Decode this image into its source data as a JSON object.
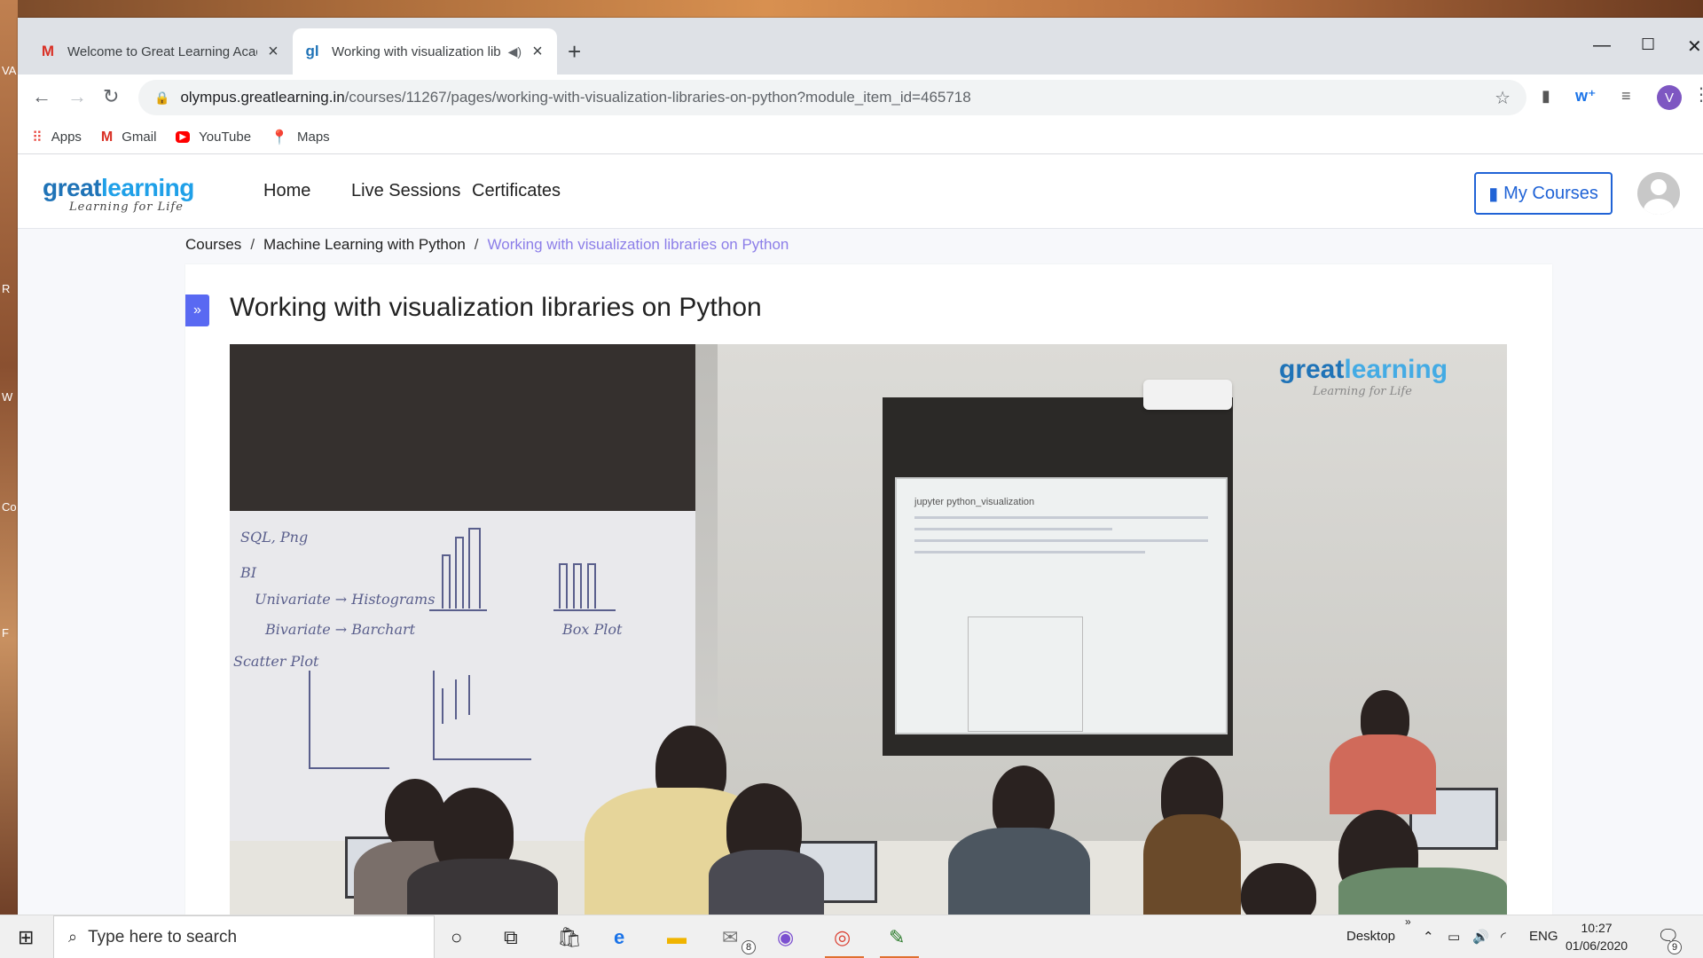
{
  "desktop": {
    "edge_labels": [
      "VA",
      "R",
      "W",
      "Co",
      "F"
    ]
  },
  "browser": {
    "tabs": [
      {
        "title": "Welcome to Great Learning Acad",
        "favicon": "gmail-icon",
        "active": false
      },
      {
        "title": "Working with visualization lib",
        "favicon": "gl-icon",
        "favicon_text": "gl",
        "active": true
      }
    ],
    "new_tab": "+",
    "url_host": "olympus.greatlearning.in",
    "url_path": "/courses/11267/pages/working-with-visualization-libraries-on-python?module_item_id=465718",
    "profile_initial": "V",
    "bookmarks": [
      {
        "label": "Apps",
        "icon": "apps-grid-icon"
      },
      {
        "label": "Gmail",
        "icon": "gmail-icon"
      },
      {
        "label": "YouTube",
        "icon": "youtube-icon"
      },
      {
        "label": "Maps",
        "icon": "maps-pin-icon"
      }
    ]
  },
  "site": {
    "logo_word_1": "great",
    "logo_word_2": "learning",
    "logo_tagline": "Learning for Life",
    "nav": [
      "Home",
      "Live Sessions",
      "Certificates"
    ],
    "my_courses": "My Courses",
    "breadcrumb": [
      "Courses",
      "Machine Learning with Python",
      "Working with visualization libraries on Python"
    ],
    "breadcrumb_sep": "/",
    "page_title": "Working with visualization libraries on Python",
    "expand_label": "»"
  },
  "video": {
    "logo_word_1": "great",
    "logo_word_2": "learning",
    "logo_tagline": "Learning for Life",
    "board_notes": [
      "SQL, Png",
      "BI",
      "Univariate → Histograms",
      "Bivariate → Barchart",
      "Scatter Plot",
      "Box Plot"
    ],
    "screen_title": "jupyter  python_visualization"
  },
  "taskbar": {
    "search_placeholder": "Type here to search",
    "desktop_label": "Desktop",
    "mail_badge": "8",
    "language": "ENG",
    "time": "10:27",
    "date": "01/06/2020",
    "notification_badge": "9"
  },
  "colors": {
    "brand_blue": "#1f73b7",
    "accent_purple": "#5969f2",
    "breadcrumb_current": "#8c7ee8",
    "my_courses_border": "#2063d6"
  }
}
